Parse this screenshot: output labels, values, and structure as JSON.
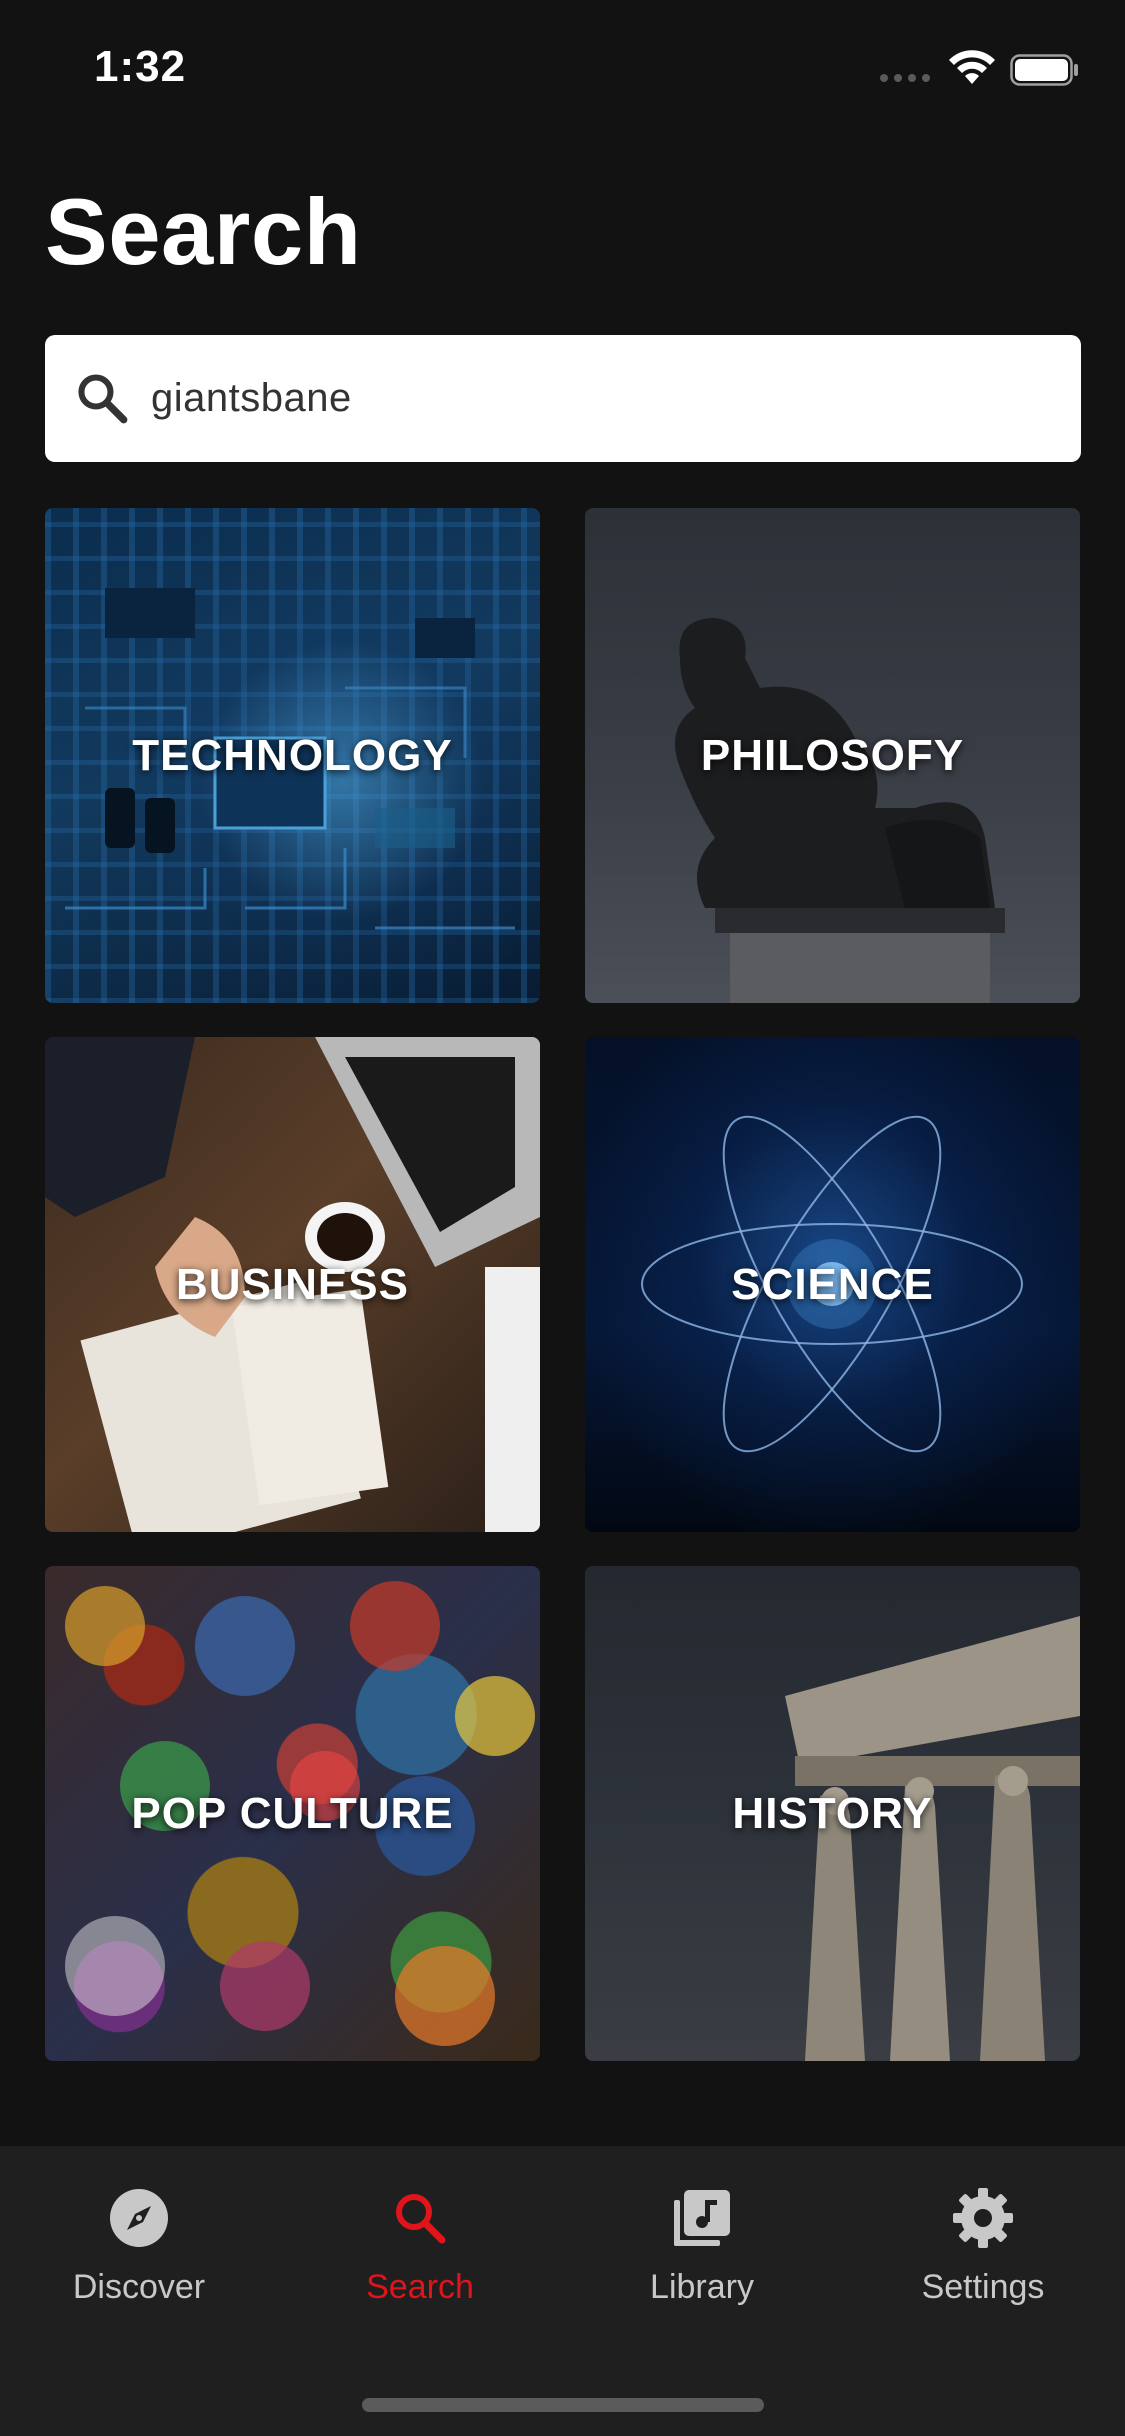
{
  "status_bar": {
    "time": "1:32"
  },
  "page": {
    "title": "Search"
  },
  "search": {
    "value": "giantsbane",
    "icon": "search-icon"
  },
  "categories": [
    {
      "label": "TECHNOLOGY",
      "image": "circuit-board"
    },
    {
      "label": "PHILOSOFY",
      "image": "thinker-statue"
    },
    {
      "label": "BUSINESS",
      "image": "business-desk"
    },
    {
      "label": "SCIENCE",
      "image": "atom"
    },
    {
      "label": "POP CULTURE",
      "image": "cartoon-collage"
    },
    {
      "label": "HISTORY",
      "image": "caryatid-columns"
    }
  ],
  "tab_bar": {
    "active": "Search",
    "tabs": [
      {
        "label": "Discover",
        "icon": "compass-icon"
      },
      {
        "label": "Search",
        "icon": "search-icon"
      },
      {
        "label": "Library",
        "icon": "library-icon"
      },
      {
        "label": "Settings",
        "icon": "gear-icon"
      }
    ]
  },
  "colors": {
    "background": "#121212",
    "tab_bar": "#1f1f1f",
    "accent": "#e0141b",
    "inactive": "#c8c8c8"
  }
}
